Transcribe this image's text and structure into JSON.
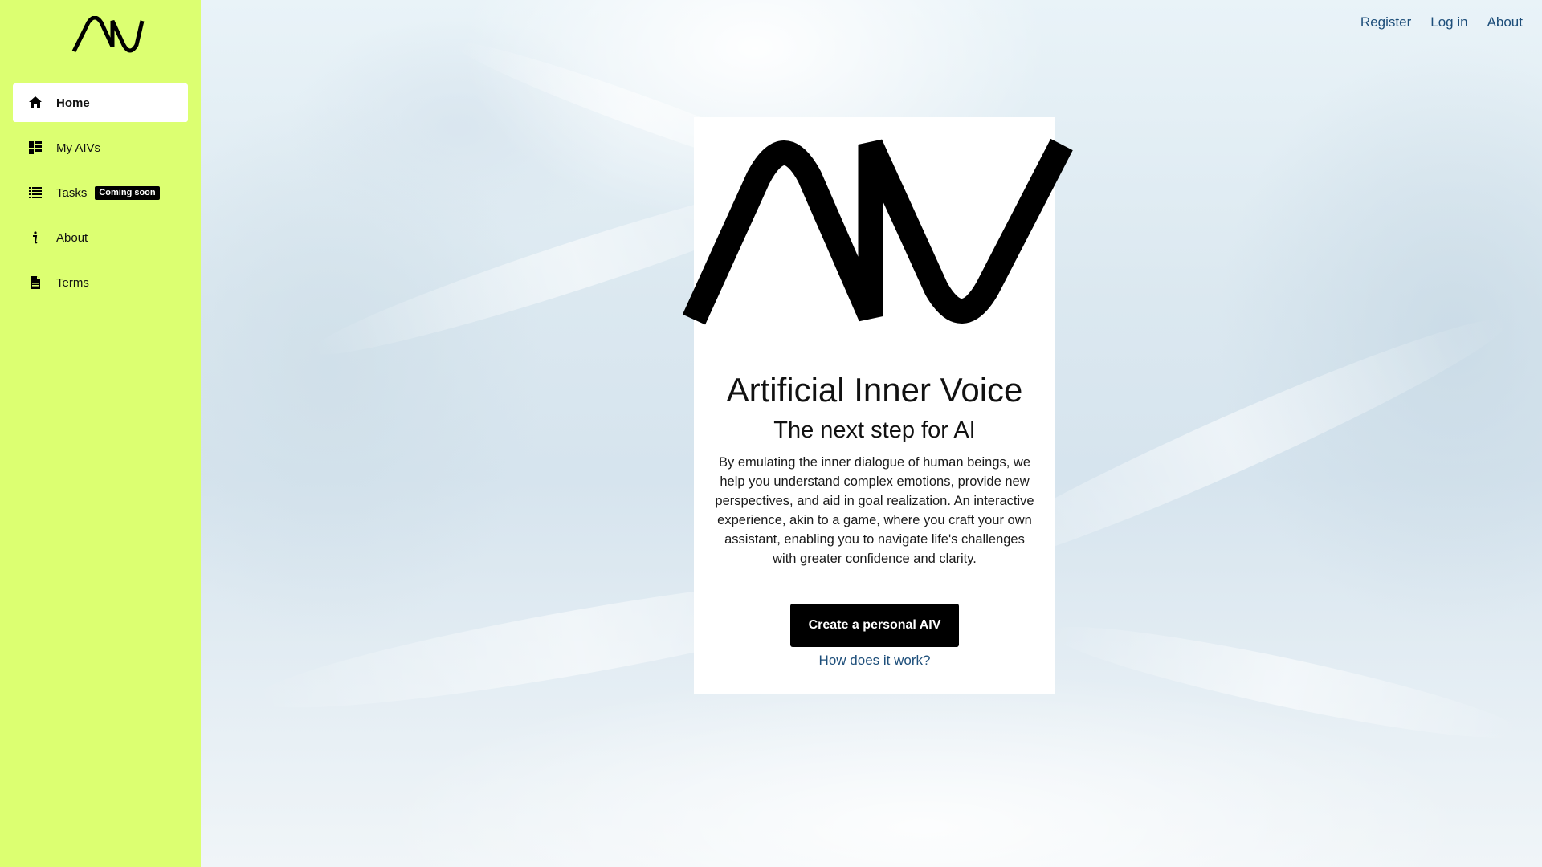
{
  "sidebar": {
    "background_color": "#dcff71",
    "logo_icon": "aiv-logo",
    "items": [
      {
        "label": "Home",
        "icon": "home-icon",
        "active": true
      },
      {
        "label": "My AIVs",
        "icon": "dashboard-icon",
        "active": false
      },
      {
        "label": "Tasks",
        "icon": "list-icon",
        "active": false,
        "badge": "Coming soon"
      },
      {
        "label": "About",
        "icon": "info-icon",
        "active": false
      },
      {
        "label": "Terms",
        "icon": "document-icon",
        "active": false
      }
    ]
  },
  "header": {
    "links": [
      {
        "label": "Register"
      },
      {
        "label": "Log in"
      },
      {
        "label": "About"
      }
    ],
    "link_color": "#1d4e7a"
  },
  "hero": {
    "logo_icon": "aiv-logo",
    "title": "Artificial Inner Voice",
    "subtitle": "The next step for AI",
    "description": "By emulating the inner dialogue of human beings, we help you understand complex emotions, provide new perspectives, and aid in goal realization. An interactive experience, akin to a game, where you craft your own assistant, enabling you to navigate life's challenges with greater confidence and clarity.",
    "cta_label": "Create a personal AIV",
    "secondary_link": "How does it work?"
  }
}
